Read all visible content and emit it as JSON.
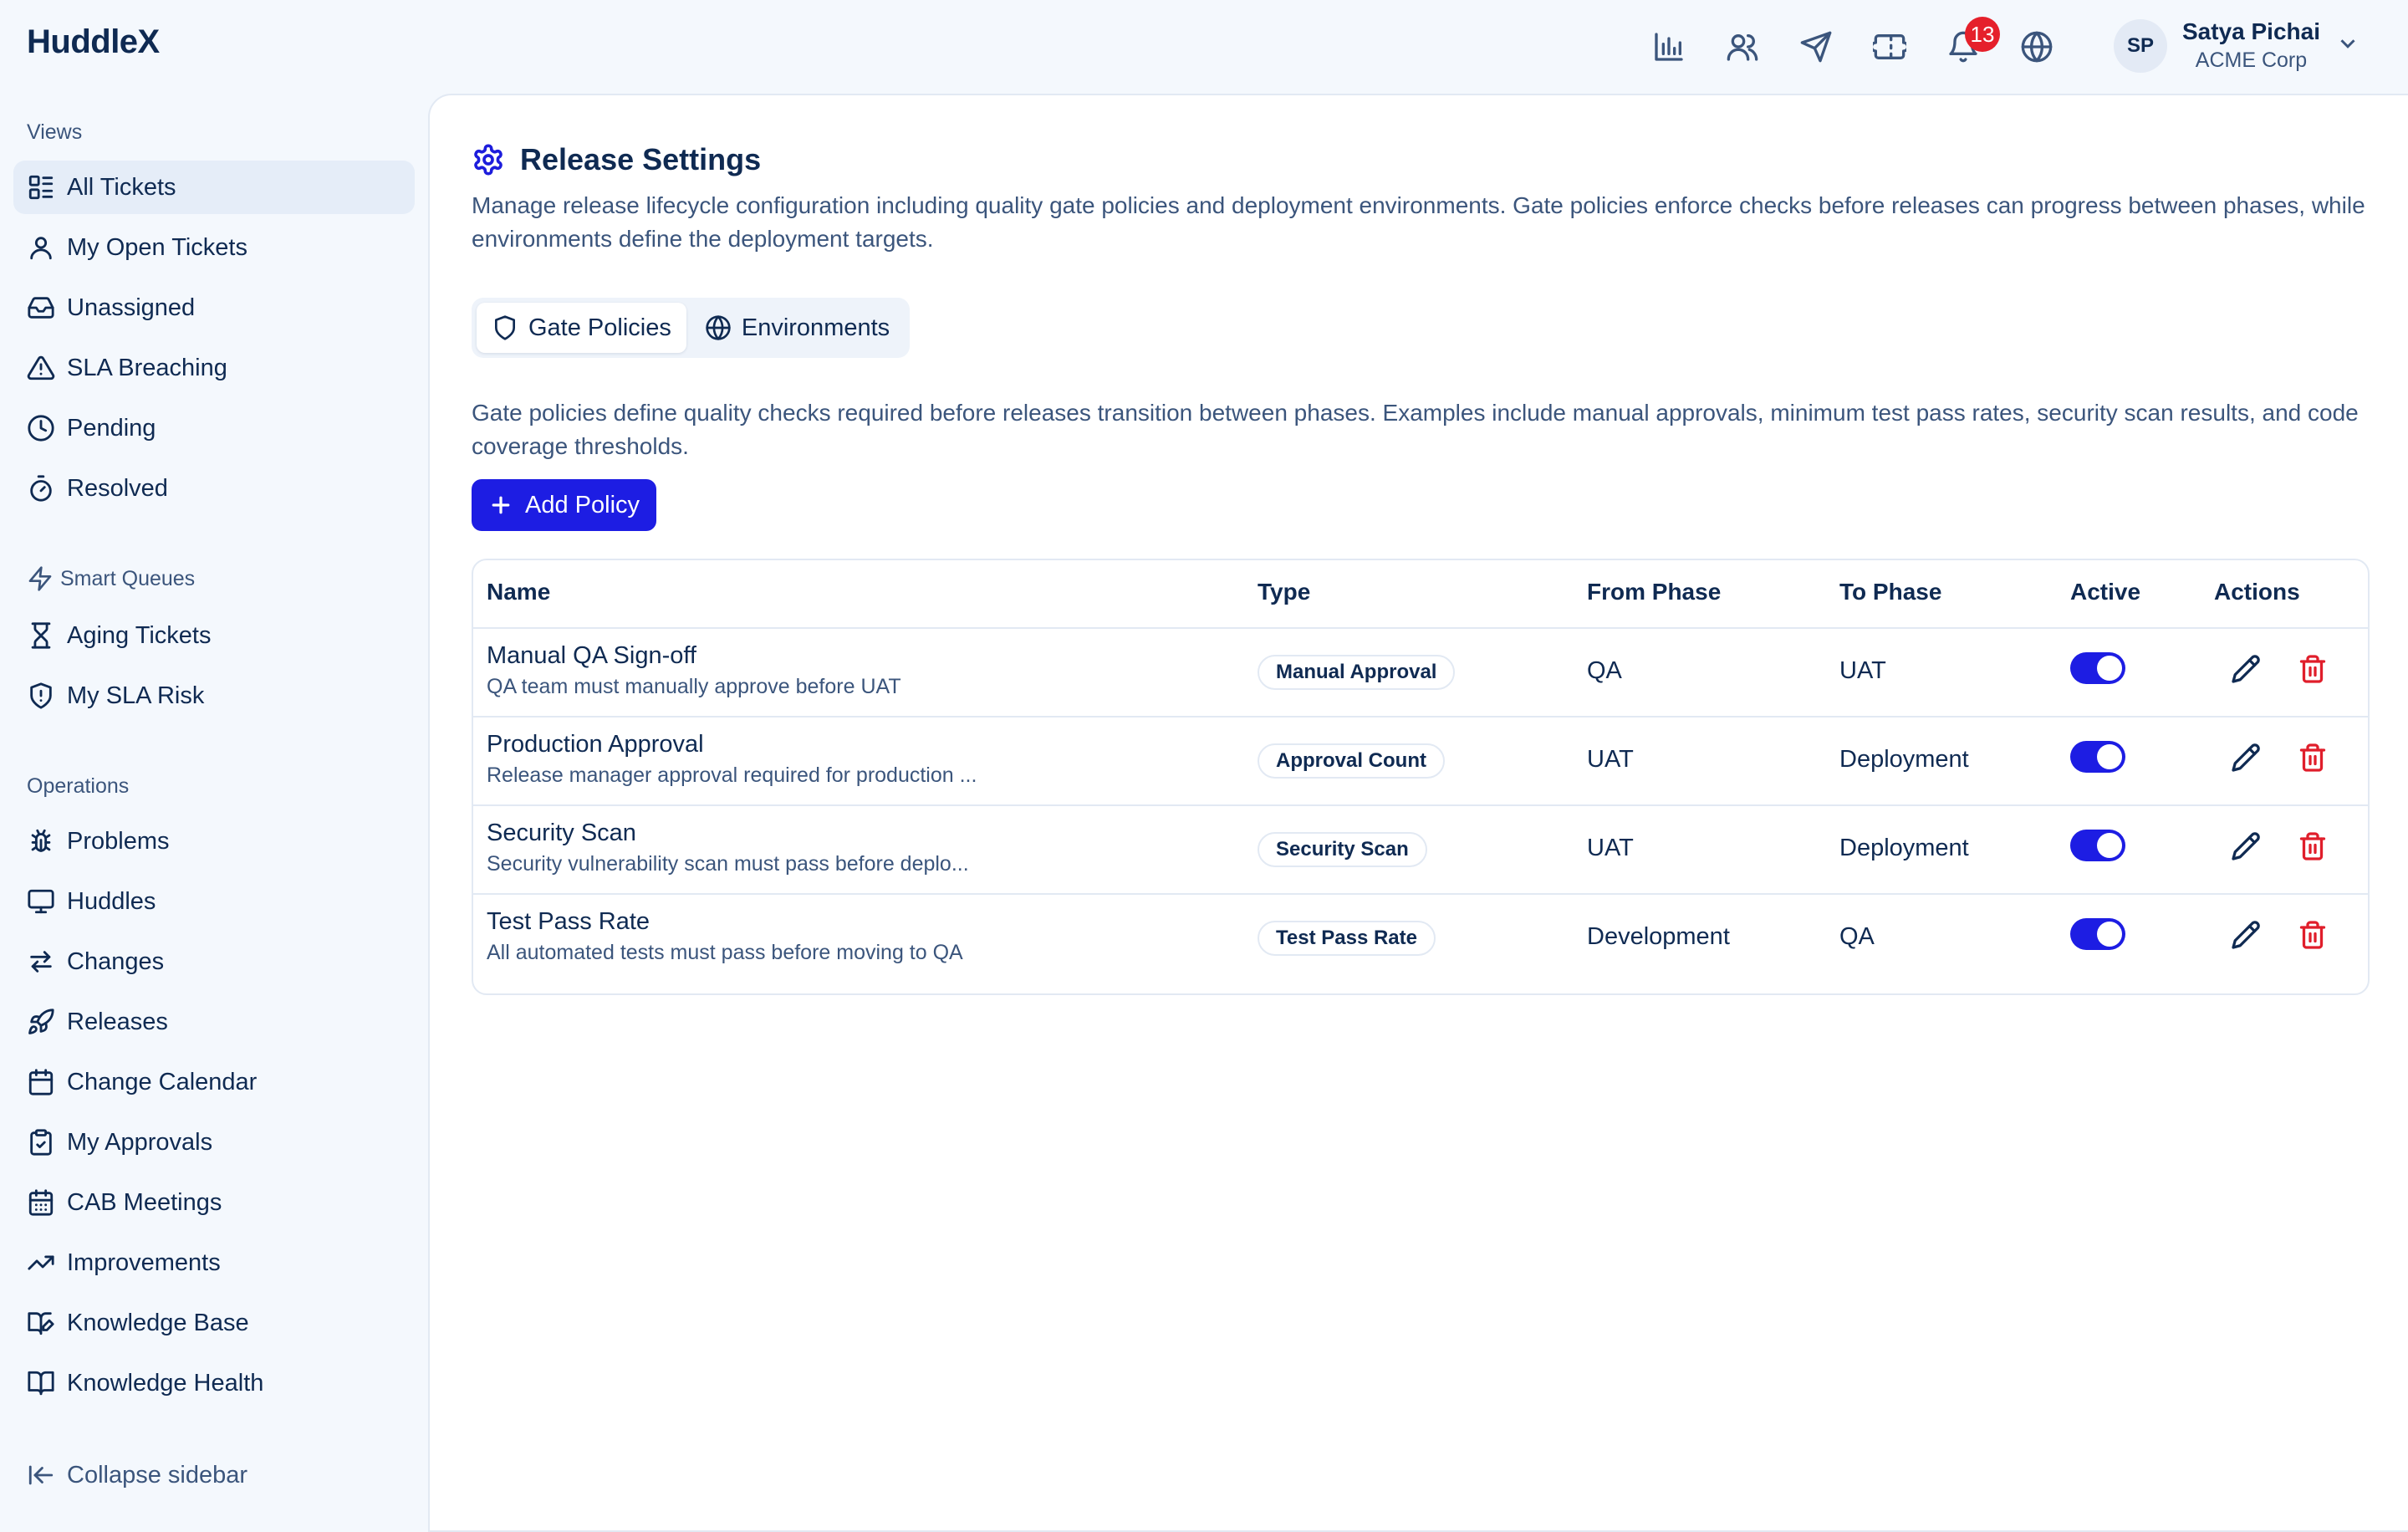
{
  "app": {
    "brand": "HuddleX"
  },
  "topbar": {
    "icons": [
      "bar-chart-icon",
      "users-icon",
      "send-icon",
      "ticket-icon",
      "bell-icon",
      "globe-icon"
    ],
    "notification_count": "13",
    "user": {
      "initials": "SP",
      "name": "Satya Pichai",
      "org": "ACME Corp"
    }
  },
  "sidebar": {
    "views_label": "Views",
    "views": [
      {
        "label": "All Tickets",
        "icon": "list-icon",
        "active": true
      },
      {
        "label": "My Open Tickets",
        "icon": "user-icon"
      },
      {
        "label": "Unassigned",
        "icon": "inbox-icon"
      },
      {
        "label": "SLA Breaching",
        "icon": "warning-icon"
      },
      {
        "label": "Pending",
        "icon": "clock-icon"
      },
      {
        "label": "Resolved",
        "icon": "timer-icon"
      }
    ],
    "smart_label": "Smart Queues",
    "smart": [
      {
        "label": "Aging Tickets",
        "icon": "hourglass-icon"
      },
      {
        "label": "My SLA Risk",
        "icon": "shield-alert-icon"
      }
    ],
    "ops_label": "Operations",
    "ops": [
      {
        "label": "Problems",
        "icon": "bug-icon"
      },
      {
        "label": "Huddles",
        "icon": "monitor-icon"
      },
      {
        "label": "Changes",
        "icon": "arrows-swap-icon"
      },
      {
        "label": "Releases",
        "icon": "rocket-icon"
      },
      {
        "label": "Change Calendar",
        "icon": "calendar-icon"
      },
      {
        "label": "My Approvals",
        "icon": "clipboard-check-icon"
      },
      {
        "label": "CAB Meetings",
        "icon": "calendar-grid-icon"
      },
      {
        "label": "Improvements",
        "icon": "trending-up-icon"
      },
      {
        "label": "Knowledge Base",
        "icon": "book-edit-icon"
      },
      {
        "label": "Knowledge Health",
        "icon": "book-open-icon"
      }
    ],
    "collapse_label": "Collapse sidebar"
  },
  "page": {
    "title": "Release Settings",
    "description": "Manage release lifecycle configuration including quality gate policies and deployment environments. Gate policies enforce checks before releases can progress between phases, while environments define the deployment targets.",
    "tabs": [
      {
        "label": "Gate Policies",
        "active": true
      },
      {
        "label": "Environments",
        "active": false
      }
    ],
    "gate_description": "Gate policies define quality checks required before releases transition between phases. Examples include manual approvals, minimum test pass rates, security scan results, and code coverage thresholds.",
    "add_button": "Add Policy"
  },
  "table": {
    "headers": {
      "name": "Name",
      "type": "Type",
      "from": "From Phase",
      "to": "To Phase",
      "active": "Active",
      "actions": "Actions"
    },
    "rows": [
      {
        "name": "Manual QA Sign-off",
        "desc": "QA team must manually approve before UAT",
        "type": "Manual Approval",
        "from": "QA",
        "to": "UAT",
        "active": true
      },
      {
        "name": "Production Approval",
        "desc": "Release manager approval required for production ...",
        "type": "Approval Count",
        "from": "UAT",
        "to": "Deployment",
        "active": true
      },
      {
        "name": "Security Scan",
        "desc": "Security vulnerability scan must pass before deplo...",
        "type": "Security Scan",
        "from": "UAT",
        "to": "Deployment",
        "active": true
      },
      {
        "name": "Test Pass Rate",
        "desc": "All automated tests must pass before moving to QA",
        "type": "Test Pass Rate",
        "from": "Development",
        "to": "QA",
        "active": true
      }
    ]
  },
  "colors": {
    "accent": "#1d1de3",
    "danger": "#e01e2b",
    "text": "#0f2a52",
    "muted": "#3b557c"
  }
}
